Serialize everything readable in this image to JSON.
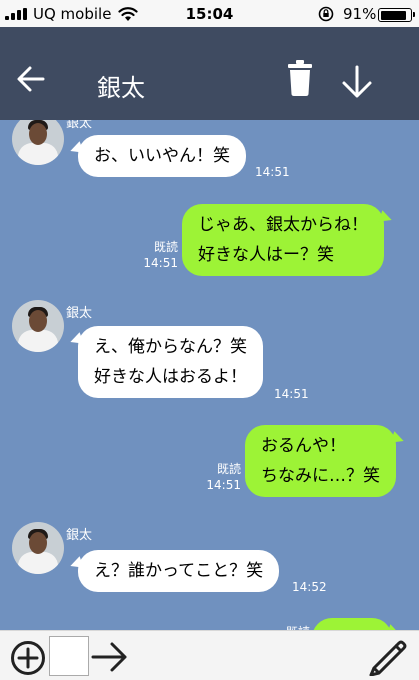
{
  "status_bar": {
    "carrier": "UQ mobile",
    "time": "15:04",
    "battery_percent": "91%",
    "battery_level": 0.91
  },
  "header": {
    "title": "銀太"
  },
  "messages": [
    {
      "side": "in",
      "sender": "銀太",
      "text": "お、いいやん！笑",
      "time": "14:51"
    },
    {
      "side": "out",
      "read": "既読",
      "lines": [
        "じゃあ、銀太からね！",
        "好きな人はー？笑"
      ],
      "time": "14:51"
    },
    {
      "side": "in",
      "sender": "銀太",
      "lines": [
        "え、俺からなん？笑",
        "好きな人はおるよ！"
      ],
      "time": "14:51"
    },
    {
      "side": "out",
      "read": "既読",
      "lines": [
        "おるんや！",
        "ちなみに…？笑"
      ],
      "time": "14:51"
    },
    {
      "side": "in",
      "sender": "銀太",
      "text": "え？誰かってこと？笑",
      "time": "14:52"
    },
    {
      "side": "out",
      "read": "既読"
    }
  ],
  "input_bar": {
    "text_value": ""
  },
  "colors": {
    "chat_background": "#7091bf",
    "header": "#3f4b61",
    "outgoing_bubble": "#9df336",
    "incoming_bubble": "#ffffff"
  },
  "icons": [
    "signal-icon",
    "wifi-icon",
    "orientation-lock-icon",
    "battery-icon",
    "back-arrow-icon",
    "trash-icon",
    "download-icon",
    "plus-circle-icon",
    "send-arrow-icon",
    "pencil-icon"
  ]
}
